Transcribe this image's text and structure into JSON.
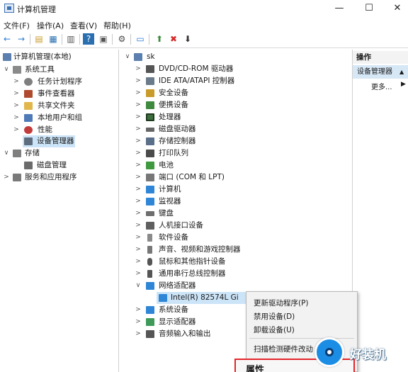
{
  "window": {
    "title": "计算机管理",
    "minimize": "—",
    "maximize": "☐",
    "close": "✕"
  },
  "menu": [
    "文件(F)",
    "操作(A)",
    "查看(V)",
    "帮助(H)"
  ],
  "toolbar": [
    "←",
    "→",
    "▤",
    "▦",
    "▥",
    "?",
    "▣",
    "⚙",
    "▭",
    "⬆",
    "✖",
    "⬇"
  ],
  "left_tree": [
    {
      "label": "计算机管理(本地)",
      "icon": "computer-icon",
      "color": "#5b7fae",
      "expander": ""
    },
    {
      "label": "系统工具",
      "icon": "tools-icon",
      "color": "#8a8a8a",
      "expander": "∨"
    },
    {
      "label": "任务计划程序",
      "icon": "clock-icon",
      "color": "#7f7f7f",
      "expander": ">"
    },
    {
      "label": "事件查看器",
      "icon": "event-log-icon",
      "color": "#b04a2f",
      "expander": ">"
    },
    {
      "label": "共享文件夹",
      "icon": "folder-icon",
      "color": "#e1b64a",
      "expander": ">"
    },
    {
      "label": "本地用户和组",
      "icon": "users-icon",
      "color": "#4f7ab8",
      "expander": ">"
    },
    {
      "label": "性能",
      "icon": "performance-icon",
      "color": "#c23c3c",
      "expander": ">"
    },
    {
      "label": "设备管理器",
      "icon": "device-manager-icon",
      "color": "#5d6d7e",
      "expander": ""
    },
    {
      "label": "存储",
      "icon": "storage-icon",
      "color": "#7f7f7f",
      "expander": "∨"
    },
    {
      "label": "磁盘管理",
      "icon": "disk-icon",
      "color": "#6b6b6b",
      "expander": ""
    },
    {
      "label": "服务和应用程序",
      "icon": "services-icon",
      "color": "#7a7a7a",
      "expander": ">"
    }
  ],
  "center_tree": [
    {
      "label": "sk",
      "icon": "computer-icon",
      "color": "#5b7fae",
      "expander": "∨"
    },
    {
      "label": "DVD/CD-ROM 驱动器",
      "icon": "dvd-icon",
      "color": "#555555",
      "expander": ">"
    },
    {
      "label": "IDE ATA/ATAPI 控制器",
      "icon": "ide-icon",
      "color": "#6b7b8b",
      "expander": ">"
    },
    {
      "label": "安全设备",
      "icon": "security-icon",
      "color": "#c99b2a",
      "expander": ">"
    },
    {
      "label": "便携设备",
      "icon": "portable-icon",
      "color": "#3f8a3f",
      "expander": ">"
    },
    {
      "label": "处理器",
      "icon": "processor-icon",
      "color": "#3d6e3d",
      "expander": ">"
    },
    {
      "label": "磁盘驱动器",
      "icon": "disk-drive-icon",
      "color": "#666666",
      "expander": ">"
    },
    {
      "label": "存储控制器",
      "icon": "storage-controller-icon",
      "color": "#5a6f8a",
      "expander": ">"
    },
    {
      "label": "打印队列",
      "icon": "printer-icon",
      "color": "#4b4b4b",
      "expander": ">"
    },
    {
      "label": "电池",
      "icon": "battery-icon",
      "color": "#3f9a3f",
      "expander": ">"
    },
    {
      "label": "端口 (COM 和 LPT)",
      "icon": "port-icon",
      "color": "#777777",
      "expander": ">"
    },
    {
      "label": "计算机",
      "icon": "monitor-icon",
      "color": "#2f86d6",
      "expander": ">"
    },
    {
      "label": "监视器",
      "icon": "monitor-icon",
      "color": "#2f86d6",
      "expander": ">"
    },
    {
      "label": "键盘",
      "icon": "keyboard-icon",
      "color": "#6e6e6e",
      "expander": ">"
    },
    {
      "label": "人机接口设备",
      "icon": "hid-icon",
      "color": "#5f5f5f",
      "expander": ">"
    },
    {
      "label": "软件设备",
      "icon": "software-device-icon",
      "color": "#8a8a8a",
      "expander": ">"
    },
    {
      "label": "声音、视频和游戏控制器",
      "icon": "audio-icon",
      "color": "#777777",
      "expander": ">"
    },
    {
      "label": "鼠标和其他指针设备",
      "icon": "mouse-icon",
      "color": "#555555",
      "expander": ">"
    },
    {
      "label": "通用串行总线控制器",
      "icon": "usb-icon",
      "color": "#555555",
      "expander": ">"
    },
    {
      "label": "网络适配器",
      "icon": "network-icon",
      "color": "#2f86d6",
      "expander": "∨"
    },
    {
      "label": "Intel(R) 82574L Gi",
      "icon": "network-adapter-icon",
      "color": "#2f86d6",
      "expander": ""
    },
    {
      "label": "系统设备",
      "icon": "system-device-icon",
      "color": "#2f86d6",
      "expander": ">"
    },
    {
      "label": "显示适配器",
      "icon": "display-adapter-icon",
      "color": "#3f9a5a",
      "expander": ">"
    },
    {
      "label": "音频输入和输出",
      "icon": "speaker-icon",
      "color": "#555555",
      "expander": ">"
    }
  ],
  "actions": {
    "header": "操作",
    "item": "设备管理器",
    "item_arrow": "▲",
    "more": "更多...",
    "more_arrow": "▶"
  },
  "context_menu": {
    "update_driver": "更新驱动程序(P)",
    "disable": "禁用设备(D)",
    "uninstall": "卸载设备(U)",
    "scan": "扫描检测硬件改动",
    "properties": "属性"
  },
  "watermark": {
    "text": "好装机"
  }
}
